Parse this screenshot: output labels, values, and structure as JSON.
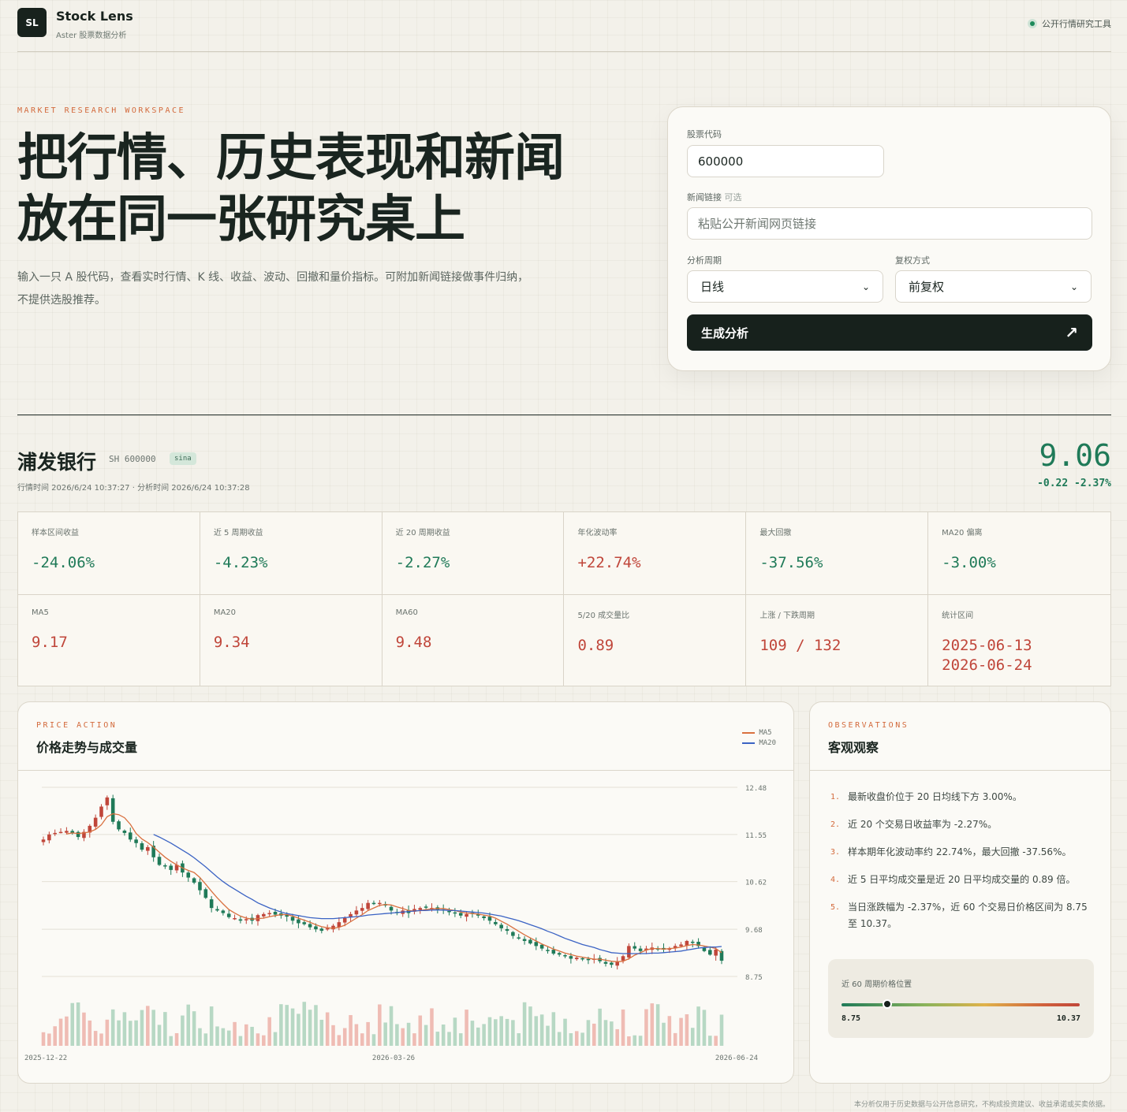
{
  "header": {
    "logo": "SL",
    "title": "Stock Lens",
    "subtitle": "Aster 股票数据分析",
    "badge": "公开行情研究工具"
  },
  "hero": {
    "eyebrow": "MARKET RESEARCH WORKSPACE",
    "title_line1": "把行情、历史表现和新闻",
    "title_line2": "放在同一张研究桌上",
    "description": "输入一只 A 股代码，查看实时行情、K 线、收益、波动、回撤和量价指标。可附加新闻链接做事件归纳，不提供选股推荐。"
  },
  "form": {
    "code_label": "股票代码",
    "code_value": "600000",
    "news_label": "新闻链接",
    "news_optional": "可选",
    "news_placeholder": "粘贴公开新闻网页链接",
    "period_label": "分析周期",
    "period_value": "日线",
    "adjust_label": "复权方式",
    "adjust_value": "前复权",
    "submit_label": "生成分析",
    "submit_icon": "arrow-up-right-icon"
  },
  "stock": {
    "name": "浦发银行",
    "code": "SH 600000",
    "source": "sina",
    "time_text": "行情时间 2026/6/24 10:37:27 · 分析时间 2026/6/24 10:37:28",
    "price": "9.06",
    "change": "-0.22 -2.37%"
  },
  "metrics": [
    {
      "label": "样本区间收益",
      "value": "-24.06%",
      "tone": "g"
    },
    {
      "label": "近 5 周期收益",
      "value": "-4.23%",
      "tone": "g"
    },
    {
      "label": "近 20 周期收益",
      "value": "-2.27%",
      "tone": "g"
    },
    {
      "label": "年化波动率",
      "value": "+22.74%",
      "tone": "r"
    },
    {
      "label": "最大回撤",
      "value": "-37.56%",
      "tone": "g"
    },
    {
      "label": "MA20 偏离",
      "value": "-3.00%",
      "tone": "g"
    },
    {
      "label": "MA5",
      "value": "9.17",
      "tone": "r"
    },
    {
      "label": "MA20",
      "value": "9.34",
      "tone": "r"
    },
    {
      "label": "MA60",
      "value": "9.48",
      "tone": "r"
    },
    {
      "label": "5/20 成交量比",
      "value": "0.89",
      "tone": "r"
    },
    {
      "label": "上涨 / 下跌周期",
      "value": "109 / 132",
      "tone": "r"
    },
    {
      "label": "统计区间",
      "value": "2025-06-13",
      "value2": "2026-06-24",
      "tone": "r"
    }
  ],
  "chart_card": {
    "eyebrow": "PRICE ACTION",
    "title": "价格走势与成交量",
    "legend": [
      {
        "name": "MA5",
        "color": "#d9703f"
      },
      {
        "name": "MA20",
        "color": "#3b63c4"
      }
    ]
  },
  "chart_data": {
    "type": "candlestick",
    "y_ticks": [
      "12.48",
      "11.55",
      "10.62",
      "9.68",
      "8.75"
    ],
    "ylim": [
      8.75,
      12.48
    ],
    "x_ticks": [
      "2025-12-22",
      "2026-03-26",
      "2026-06-24"
    ],
    "up_color": "#c0463a",
    "down_color": "#1f7a58",
    "close": [
      11.45,
      11.55,
      11.58,
      11.6,
      11.62,
      11.57,
      11.5,
      11.6,
      11.72,
      11.88,
      12.1,
      12.28,
      11.8,
      11.65,
      11.58,
      11.45,
      11.38,
      11.25,
      11.3,
      11.1,
      10.95,
      10.92,
      10.85,
      10.95,
      10.8,
      10.7,
      10.6,
      10.45,
      10.3,
      10.1,
      10.05,
      10.0,
      9.92,
      9.9,
      9.85,
      9.88,
      9.85,
      9.96,
      9.98,
      10.0,
      9.97,
      9.95,
      9.93,
      9.85,
      9.8,
      9.78,
      9.72,
      9.68,
      9.65,
      9.7,
      9.75,
      9.82,
      9.9,
      9.98,
      10.05,
      10.1,
      10.2,
      10.18,
      10.2,
      10.15,
      10.05,
      10.0,
      10.05,
      10.0,
      10.08,
      10.1,
      10.12,
      10.1,
      10.06,
      10.05,
      10.02,
      10.0,
      9.95,
      9.98,
      10.0,
      9.95,
      9.9,
      9.85,
      9.78,
      9.7,
      9.65,
      9.55,
      9.5,
      9.45,
      9.4,
      9.35,
      9.3,
      9.25,
      9.2,
      9.18,
      9.15,
      9.1,
      9.12,
      9.1,
      9.08,
      9.1,
      9.05,
      9.0,
      8.98,
      9.05,
      9.15,
      9.35,
      9.3,
      9.25,
      9.3,
      9.32,
      9.3,
      9.28,
      9.3,
      9.35,
      9.38,
      9.45,
      9.42,
      9.35,
      9.25,
      9.18,
      9.28,
      9.06
    ],
    "ma5": [
      null,
      null,
      null,
      null,
      11.56,
      11.58,
      11.57,
      11.58,
      11.6,
      11.65,
      11.74,
      11.9,
      11.96,
      11.94,
      11.88,
      11.75,
      11.57,
      11.46,
      11.39,
      11.3,
      11.2,
      11.1,
      11.02,
      10.95,
      10.89,
      10.84,
      10.8,
      10.7,
      10.57,
      10.43,
      10.3,
      10.18,
      10.07,
      10.0,
      9.94,
      9.9,
      9.88,
      9.89,
      9.9,
      9.93,
      9.95,
      9.97,
      9.97,
      9.94,
      9.9,
      9.86,
      9.82,
      9.77,
      9.73,
      9.71,
      9.7,
      9.72,
      9.76,
      9.83,
      9.9,
      9.97,
      10.05,
      10.1,
      10.15,
      10.17,
      10.16,
      10.12,
      10.09,
      10.05,
      10.04,
      10.05,
      10.07,
      10.08,
      10.09,
      10.09,
      10.07,
      10.05,
      10.02,
      10.0,
      9.99,
      9.98,
      9.96,
      9.94,
      9.9,
      9.84,
      9.78,
      9.71,
      9.64,
      9.57,
      9.51,
      9.45,
      9.39,
      9.34,
      9.29,
      9.25,
      9.21,
      9.18,
      9.15,
      9.13,
      9.11,
      9.09,
      9.09,
      9.07,
      9.05,
      9.04,
      9.05,
      9.1,
      9.17,
      9.22,
      9.27,
      9.3,
      9.3,
      9.29,
      9.3,
      9.31,
      9.33,
      9.36,
      9.38,
      9.37,
      9.35,
      9.33,
      9.3,
      9.22
    ],
    "ma20": [
      null,
      null,
      null,
      null,
      null,
      null,
      null,
      null,
      null,
      null,
      null,
      null,
      null,
      null,
      null,
      null,
      null,
      null,
      null,
      11.55,
      11.5,
      11.44,
      11.38,
      11.31,
      11.24,
      11.17,
      11.09,
      11.0,
      10.91,
      10.81,
      10.71,
      10.62,
      10.54,
      10.47,
      10.4,
      10.33,
      10.27,
      10.2,
      10.15,
      10.1,
      10.06,
      10.02,
      9.99,
      9.97,
      9.95,
      9.93,
      9.91,
      9.9,
      9.89,
      9.89,
      9.89,
      9.9,
      9.91,
      9.92,
      9.93,
      9.94,
      9.96,
      9.97,
      9.98,
      9.99,
      10.0,
      10.01,
      10.02,
      10.03,
      10.04,
      10.05,
      10.05,
      10.06,
      10.06,
      10.06,
      10.05,
      10.05,
      10.04,
      10.03,
      10.02,
      10.01,
      10.0,
      9.98,
      9.96,
      9.94,
      9.91,
      9.88,
      9.85,
      9.81,
      9.77,
      9.73,
      9.69,
      9.64,
      9.6,
      9.55,
      9.5,
      9.46,
      9.42,
      9.38,
      9.35,
      9.32,
      9.28,
      9.25,
      9.22,
      9.21,
      9.2,
      9.2,
      9.2,
      9.2,
      9.2,
      9.21,
      9.21,
      9.22,
      9.23,
      9.24,
      9.25,
      9.27,
      9.29,
      9.31,
      9.32,
      9.33,
      9.33,
      9.34
    ]
  },
  "observations": {
    "eyebrow": "OBSERVATIONS",
    "title": "客观观察",
    "items": [
      {
        "num": "1.",
        "text": "最新收盘价位于 20 日均线下方 3.00%。"
      },
      {
        "num": "2.",
        "text": "近 20 个交易日收益率为 -2.27%。"
      },
      {
        "num": "3.",
        "text": "样本期年化波动率约 22.74%，最大回撤 -37.56%。"
      },
      {
        "num": "4.",
        "text": "近 5 日平均成交量是近 20 日平均成交量的 0.89 倍。"
      },
      {
        "num": "5.",
        "text": "当日涨跌幅为 -2.37%，近 60 个交易日价格区间为 8.75 至 10.37。"
      }
    ],
    "range_label": "近 60 周期价格位置",
    "range_min": "8.75",
    "range_max": "10.37",
    "range_current": 9.06
  },
  "disclaimer": "本分析仅用于历史数据与公开信息研究，不构成投资建议、收益承诺或买卖依据。"
}
